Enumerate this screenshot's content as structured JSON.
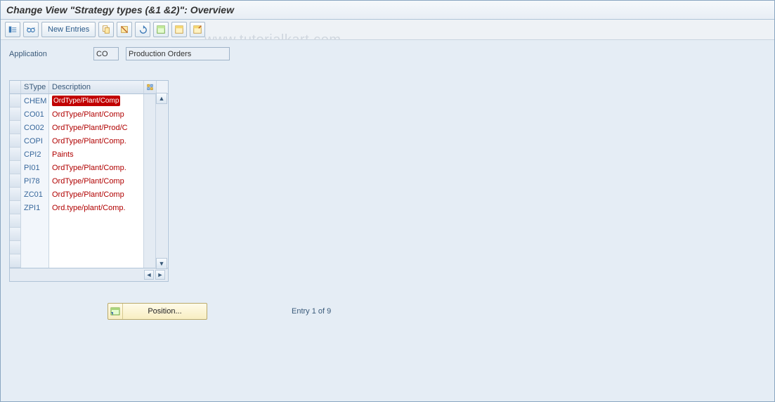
{
  "title": "Change View \"Strategy types (&1 &2)\": Overview",
  "toolbar": {
    "new_entries": "New Entries",
    "icons": [
      "details",
      "glasses",
      "copy",
      "delete",
      "undo",
      "selectall",
      "selectblock",
      "deselect"
    ]
  },
  "field": {
    "label": "Application",
    "code": "CO",
    "desc": "Production Orders"
  },
  "grid": {
    "headers": {
      "stype": "SType",
      "desc": "Description"
    },
    "rows": [
      {
        "stype": "CHEM",
        "desc": "OrdType/Plant/Comp",
        "hl": true
      },
      {
        "stype": "CO01",
        "desc": "OrdType/Plant/Comp",
        "hl": false
      },
      {
        "stype": "CO02",
        "desc": "OrdType/Plant/Prod/C",
        "hl": false
      },
      {
        "stype": "COPI",
        "desc": "OrdType/Plant/Comp.",
        "hl": false
      },
      {
        "stype": "CPI2",
        "desc": "Paints",
        "hl": false
      },
      {
        "stype": "PI01",
        "desc": "OrdType/Plant/Comp.",
        "hl": false
      },
      {
        "stype": "PI78",
        "desc": "OrdType/Plant/Comp",
        "hl": false
      },
      {
        "stype": "ZC01",
        "desc": "OrdType/Plant/Comp",
        "hl": false
      },
      {
        "stype": "ZPI1",
        "desc": "Ord.type/plant/Comp.",
        "hl": false
      },
      {
        "stype": "",
        "desc": "",
        "hl": false
      },
      {
        "stype": "",
        "desc": "",
        "hl": false
      },
      {
        "stype": "",
        "desc": "",
        "hl": false
      },
      {
        "stype": "",
        "desc": "",
        "hl": false
      }
    ]
  },
  "position_btn": "Position...",
  "entry_text": "Entry 1 of 9",
  "watermark": "www.tutorialkart.com"
}
